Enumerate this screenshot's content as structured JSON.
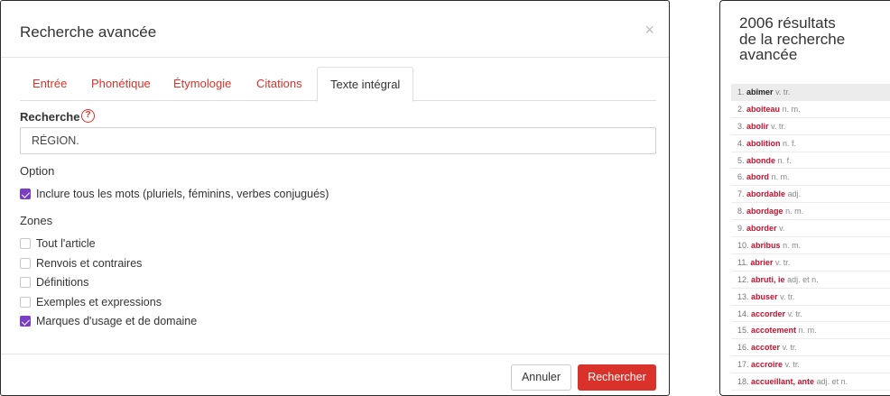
{
  "modal": {
    "title": "Recherche avancée",
    "close_glyph": "×",
    "tabs": [
      {
        "label": "Entrée"
      },
      {
        "label": "Phonétique"
      },
      {
        "label": "Étymologie"
      },
      {
        "label": "Citations"
      },
      {
        "label": "Texte intégral"
      }
    ],
    "active_tab": "Texte intégral",
    "search_label": "Recherche",
    "help_glyph": "?",
    "search_value": "RÉGION.",
    "option_label": "Option",
    "option_checkbox": {
      "label": "Inclure tous les mots (pluriels, féminins, verbes conjugués)",
      "checked": true
    },
    "zones_label": "Zones",
    "zones": [
      {
        "label": "Tout l'article",
        "checked": false
      },
      {
        "label": "Renvois et contraires",
        "checked": false
      },
      {
        "label": "Définitions",
        "checked": false
      },
      {
        "label": "Exemples et expressions",
        "checked": false
      },
      {
        "label": "Marques d'usage et de domaine",
        "checked": true
      }
    ],
    "cancel_label": "Annuler",
    "submit_label": "Rechercher"
  },
  "results": {
    "title_line1": "2006 résultats",
    "title_line2": "de la recherche",
    "title_line3": "avancée",
    "items": [
      {
        "num": "1.",
        "word": "abîmer",
        "gram": "v. tr."
      },
      {
        "num": "2.",
        "word": "aboiteau",
        "gram": "n. m."
      },
      {
        "num": "3.",
        "word": "abolir",
        "gram": "v. tr."
      },
      {
        "num": "4.",
        "word": "abolition",
        "gram": "n. f."
      },
      {
        "num": "5.",
        "word": "abonde",
        "gram": "n. f."
      },
      {
        "num": "6.",
        "word": "abord",
        "gram": "n. m."
      },
      {
        "num": "7.",
        "word": "abordable",
        "gram": "adj."
      },
      {
        "num": "8.",
        "word": "abordage",
        "gram": "n. m."
      },
      {
        "num": "9.",
        "word": "aborder",
        "gram": "v."
      },
      {
        "num": "10.",
        "word": "abribus",
        "gram": "n. m."
      },
      {
        "num": "11.",
        "word": "abrier",
        "gram": "v. tr."
      },
      {
        "num": "12.",
        "word": "abruti, ie",
        "gram": "adj. et n."
      },
      {
        "num": "13.",
        "word": "abuser",
        "gram": "v. tr."
      },
      {
        "num": "14.",
        "word": "accorder",
        "gram": "v. tr."
      },
      {
        "num": "15.",
        "word": "accotement",
        "gram": "n. m."
      },
      {
        "num": "16.",
        "word": "accoter",
        "gram": "v. tr."
      },
      {
        "num": "17.",
        "word": "accroire",
        "gram": "v. tr."
      },
      {
        "num": "18.",
        "word": "accueillant, ante",
        "gram": "adj. et n."
      }
    ]
  },
  "colors": {
    "accent": "#d8322a",
    "checkbox": "#7a3fc2",
    "result_word": "#c8102e"
  }
}
